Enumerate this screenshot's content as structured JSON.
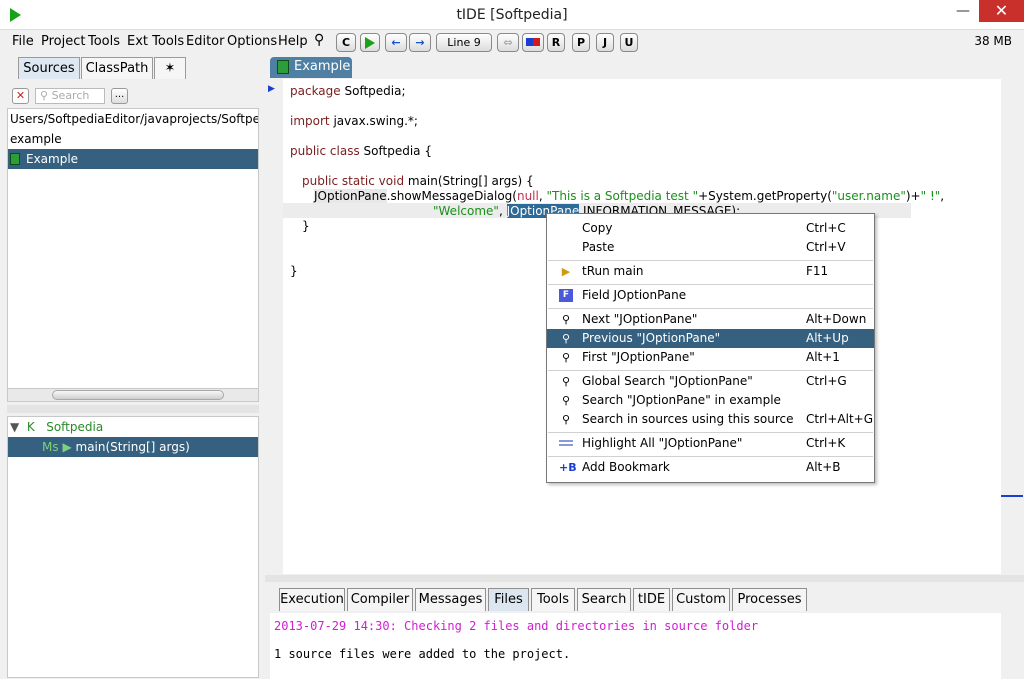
{
  "window": {
    "title": "tIDE [Softpedia]",
    "minimize": "—",
    "maximize": "☐",
    "close": "✕"
  },
  "menubar": {
    "items": [
      "File",
      "Project",
      "Tools",
      "Ext Tools",
      "Editor",
      "Options",
      "Help"
    ],
    "toolbar": {
      "c": "C",
      "line": "Line 9",
      "r": "R",
      "p": "P",
      "j": "J",
      "u": "U"
    },
    "memory": "38 MB"
  },
  "left": {
    "tabs": [
      "Sources",
      "ClassPath",
      "✶"
    ],
    "search_placeholder": "Search",
    "more": "...",
    "list": [
      "Users/SoftpediaEditor/javaprojects/Softpedia/",
      "example",
      "Example"
    ],
    "outline": {
      "class_kind": "K",
      "class_name": "Softpedia",
      "method_kind": "Ms",
      "method_name": "main(String[] args)"
    }
  },
  "editor": {
    "tab": "Example",
    "code": {
      "l1_kw": "package",
      "l1_rest": " Softpedia;",
      "l2_kw": "import",
      "l2_rest": " javax.swing.*;",
      "l3_kw": "public class",
      "l3_rest": " Softpedia {",
      "l4_kw": "public static void",
      "l4_rest": " main(String[] args) {",
      "l5_a": "JOptionPane",
      "l5_b": ".showMessageDialog(",
      "l5_null": "null",
      "l5_c": ", ",
      "l5_str": "\"This is a Softpedia test \"",
      "l5_d": "+System.getProperty(",
      "l5_str2": "\"user.name\"",
      "l5_e": ")+",
      "l5_str3": "\" !\"",
      "l5_f": ",",
      "l6_str": "\"Welcome\"",
      "l6_a": ", ",
      "l6_sel": "JOptionPane",
      "l6_b": ".INFORMATION_MESSAGE);",
      "l7": "}",
      "l8": "}"
    }
  },
  "context_menu": {
    "copy": {
      "label": "Copy",
      "accel": "Ctrl+C"
    },
    "paste": {
      "label": "Paste",
      "accel": "Ctrl+V"
    },
    "run": {
      "label": "tRun main",
      "accel": "F11"
    },
    "field": {
      "label": "Field JOptionPane",
      "accel": ""
    },
    "next": {
      "label": "Next \"JOptionPane\"",
      "accel": "Alt+Down"
    },
    "previous": {
      "label": "Previous \"JOptionPane\"",
      "accel": "Alt+Up"
    },
    "first": {
      "label": "First \"JOptionPane\"",
      "accel": "Alt+1"
    },
    "global": {
      "label": "Global Search \"JOptionPane\"",
      "accel": "Ctrl+G"
    },
    "search_in": {
      "label": "Search \"JOptionPane\" in example",
      "accel": ""
    },
    "search_sources": {
      "label": "Search in sources using this source",
      "accel": "Ctrl+Alt+G"
    },
    "highlight": {
      "label": "Highlight All \"JOptionPane\"",
      "accel": "Ctrl+K"
    },
    "bookmark": {
      "label": "Add Bookmark",
      "accel": "Alt+B"
    }
  },
  "bottom": {
    "tabs": [
      "Execution",
      "Compiler",
      "Messages",
      "Files",
      "Tools",
      "Search",
      "tIDE",
      "Custom",
      "Processes"
    ],
    "console": [
      "2013-07-29 14:30: Checking 2 files and directories in source folder",
      "1 source files were added to the project."
    ]
  },
  "colors": {
    "selection": "#35607f",
    "tab_active": "#4f7fa3",
    "console_magenta": "#d020d0",
    "keyword": "#7a1e1e",
    "string": "#1a8f1a"
  }
}
